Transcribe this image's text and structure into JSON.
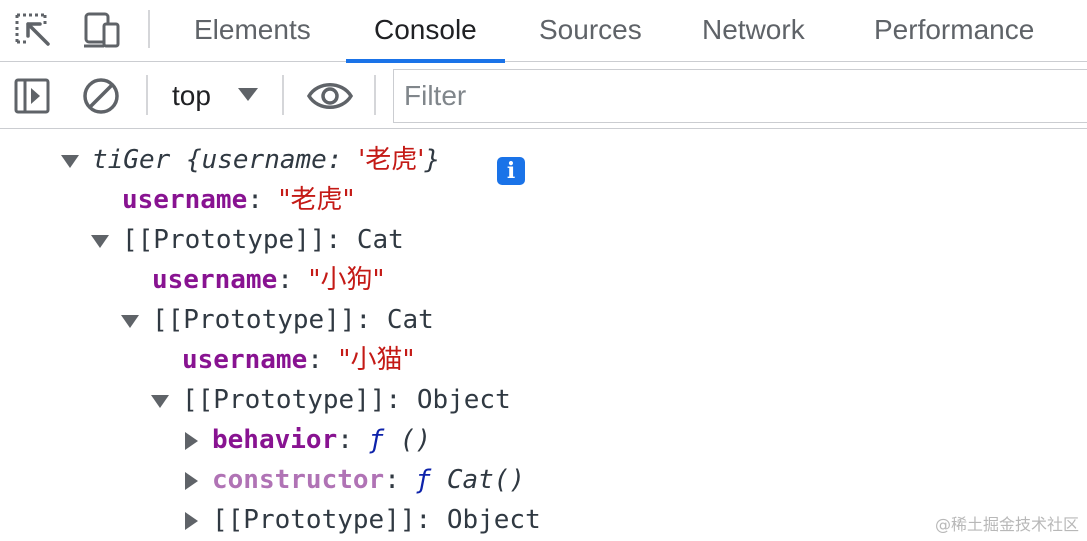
{
  "tabbar": {
    "icons": [
      "inspect-element-icon",
      "device-toolbar-icon"
    ],
    "tabs": [
      {
        "label": "Elements",
        "active": false
      },
      {
        "label": "Console",
        "active": true
      },
      {
        "label": "Sources",
        "active": false
      },
      {
        "label": "Network",
        "active": false
      },
      {
        "label": "Performance",
        "active": false
      }
    ]
  },
  "toolbar": {
    "icons": [
      "sidebar-toggle-icon",
      "clear-console-icon",
      "live-expression-eye-icon"
    ],
    "context": "top",
    "filter_placeholder": "Filter",
    "filter_value": ""
  },
  "console": {
    "rows": [
      {
        "expanded": true,
        "name": "tiGer",
        "preview_key": "username",
        "preview_value": "'老虎'"
      },
      {
        "key": "username",
        "value": "\"老虎\""
      },
      {
        "expanded": true,
        "key": "[[Prototype]]",
        "value": "Cat"
      },
      {
        "key": "username",
        "value": "\"小狗\""
      },
      {
        "expanded": true,
        "key": "[[Prototype]]",
        "value": "Cat"
      },
      {
        "key": "username",
        "value": "\"小猫\""
      },
      {
        "expanded": true,
        "key": "[[Prototype]]",
        "value": "Object"
      },
      {
        "expanded": false,
        "key": "behavior",
        "fn_symbol": "ƒ",
        "value": "()"
      },
      {
        "expanded": false,
        "key": "constructor",
        "fn_symbol": "ƒ",
        "value": "Cat()"
      },
      {
        "expanded": false,
        "key": "[[Prototype]]",
        "value": "Object"
      }
    ]
  },
  "colors": {
    "active_tab_underline": "#1a73e8",
    "property_key": "#881391",
    "non_enumerable_key": "#b073b5",
    "string_value": "#c41a16",
    "function_value": "#0d22aa"
  },
  "watermark": "@稀土掘金技术社区"
}
